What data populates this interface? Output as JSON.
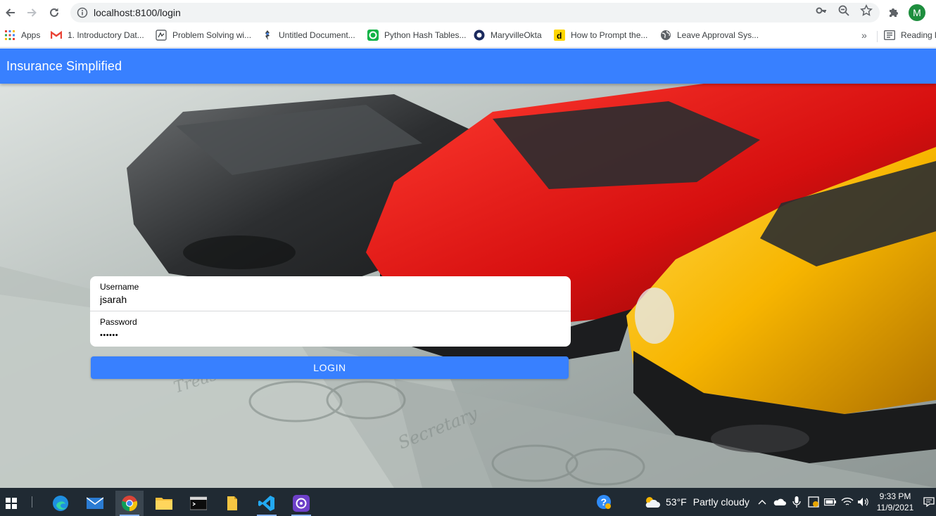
{
  "browser": {
    "url": "localhost:8100/login",
    "profile_initial": "M",
    "bookmarks": [
      {
        "label": "Apps",
        "icon": "apps-grid-icon"
      },
      {
        "label": "1. Introductory Dat...",
        "icon": "gmail-icon"
      },
      {
        "label": "Problem Solving wi...",
        "icon": "book-icon"
      },
      {
        "label": "Untitled Document...",
        "icon": "document-icon"
      },
      {
        "label": "Python Hash Tables...",
        "icon": "green-circle-icon"
      },
      {
        "label": "MaryvilleOkta",
        "icon": "okta-icon"
      },
      {
        "label": "How to Prompt the...",
        "icon": "d-logo-icon"
      },
      {
        "label": "Leave Approval Sys...",
        "icon": "globe-icon"
      }
    ],
    "more_bookmarks": "»",
    "reading_list": "Reading l"
  },
  "app": {
    "title": "Insurance Simplified"
  },
  "login": {
    "username_label": "Username",
    "username_value": "jsarah",
    "password_label": "Password",
    "password_value": "••••••",
    "button_label": "LOGIN"
  },
  "taskbar": {
    "weather_temp": "53°F",
    "weather_desc": "Partly cloudy",
    "time": "9:33 PM",
    "date": "11/9/2021"
  },
  "colors": {
    "primary": "#3880ff",
    "taskbar": "#202a33"
  }
}
